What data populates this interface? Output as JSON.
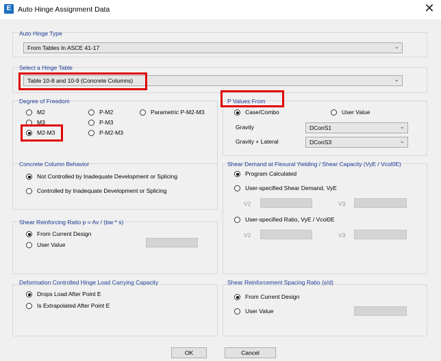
{
  "window": {
    "title": "Auto Hinge Assignment Data",
    "app_icon": "E"
  },
  "auto_hinge_type": {
    "label": "Auto Hinge Type",
    "value": "From Tables In ASCE 41-17"
  },
  "hinge_table": {
    "label": "Select a Hinge Table",
    "value": "Table 10-8 and 10-9 (Concrete Columns)"
  },
  "dof": {
    "label": "Degree of Freedom",
    "options": {
      "m2": "M2",
      "m3": "M3",
      "m2m3": "M2-M3",
      "pm2": "P-M2",
      "pm3": "P-M3",
      "pm2m3": "P-M2-M3",
      "param": "Parametric P-M2-M3"
    },
    "selected": "M2-M3"
  },
  "p_values": {
    "label": "P Values From",
    "case_combo": "Case/Combo",
    "user_value": "User Value",
    "gravity_label": "Gravity",
    "gravity_value": "DConS1",
    "gravity_lateral_label": "Gravity + Lateral",
    "gravity_lateral_value": "DConS3",
    "selected": "Case/Combo"
  },
  "concrete_behavior": {
    "label": "Concrete Column Behavior",
    "opt1": "Not Controlled by Inadequate Development or Splicing",
    "opt2": "Controlled by Inadequate Development or Splicing",
    "selected": "Not Controlled by Inadequate Development or Splicing"
  },
  "shear_demand": {
    "label": "Shear Demand at Flexural Yielding / Shear Capacity (VyE / Vcol0E)",
    "opt1": "Program Calculated",
    "opt2": "User-specified Shear Demand, VyE",
    "opt3": "User-specified Ratio, VyE / Vcol0E",
    "v2": "V2",
    "v3": "V3",
    "selected": "Program Calculated"
  },
  "shear_ratio": {
    "label": "Shear Reinforcing Ratio p = Av / (bw * s)",
    "opt1": "From Current Design",
    "opt2": "User Value",
    "selected": "From Current Design"
  },
  "deformation": {
    "label": "Deformation Controlled Hinge Load Carrying Capacity",
    "opt1": "Drops Load After Point E",
    "opt2": "Is Extrapolated After Point E",
    "selected": "Drops Load After Point E"
  },
  "spacing": {
    "label": "Shear Reinforcement Spacing Ratio (s/d)",
    "opt1": "From Current Design",
    "opt2": "User Value",
    "selected": "From Current Design"
  },
  "buttons": {
    "ok": "OK",
    "cancel": "Cancel"
  },
  "highlight_color": "#e00000"
}
